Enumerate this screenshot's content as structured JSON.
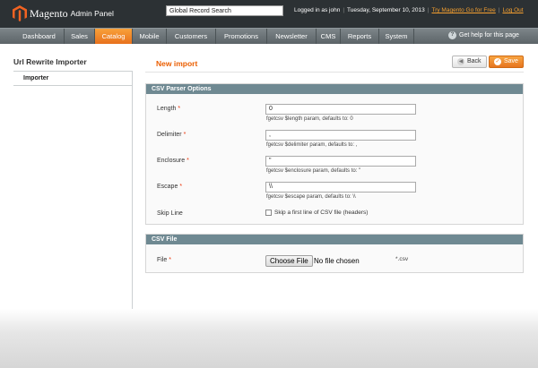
{
  "header": {
    "logo_text": "Magento",
    "logo_sub": "Admin Panel",
    "search_value": "Global Record Search",
    "logged_in": "Logged in as john",
    "date": "Tuesday, September 10, 2013",
    "try_link": "Try Magento Go for Free",
    "logout": "Log Out"
  },
  "nav": {
    "items": [
      "Dashboard",
      "Sales",
      "Catalog",
      "Mobile",
      "Customers",
      "Promotions",
      "Newsletter",
      "CMS",
      "Reports",
      "System"
    ],
    "active": "Catalog",
    "help": "Get help for this page"
  },
  "sidebar": {
    "title": "Url Rewrite Importer",
    "item": "Importer"
  },
  "main": {
    "title": "New import",
    "back_label": "Back",
    "save_label": "Save",
    "csv_section": "CSV Parser Options",
    "fields": [
      {
        "label": "Length",
        "required": true,
        "value": "0",
        "note": "fgetcsv $length param, defaults to: 0"
      },
      {
        "label": "Delimiter",
        "required": true,
        "value": ",",
        "note": "fgetcsv $delimiter param, defaults to: ,"
      },
      {
        "label": "Enclosure",
        "required": true,
        "value": "\"",
        "note": "fgetcsv $enclosure param, defaults to: \""
      },
      {
        "label": "Escape",
        "required": true,
        "value": "\\\\",
        "note": "fgetcsv $escape param, defaults to: \\\\"
      }
    ],
    "skip_label": "Skip Line",
    "skip_text": "Skip a first line of CSV file (headers)",
    "file_section": "CSV File",
    "file_label": "File",
    "file_button": "Choose File",
    "file_status": "No file chosen",
    "file_ext": "*.csv"
  },
  "colors": {
    "accent": "#eb5e00",
    "header_bg": "#2c3134",
    "section_head": "#6f8992"
  }
}
